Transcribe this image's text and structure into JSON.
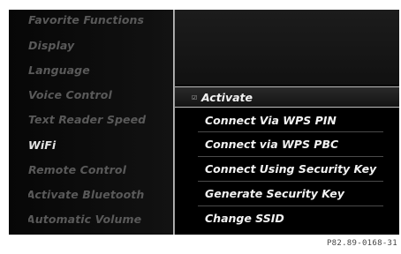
{
  "left_menu": {
    "items": [
      {
        "label": "Favorite Functions",
        "state": "normal"
      },
      {
        "label": "Display",
        "state": "normal"
      },
      {
        "label": "Language",
        "state": "normal"
      },
      {
        "label": "Voice Control",
        "state": "normal"
      },
      {
        "label": "Text Reader Speed",
        "state": "normal"
      },
      {
        "label": "WiFi",
        "state": "selected"
      },
      {
        "label": "Remote Control",
        "state": "normal"
      },
      {
        "label": "Activate Bluetooth",
        "state": "checked"
      },
      {
        "label": "Automatic Volume",
        "state": "option"
      }
    ],
    "check_glyph": "☑",
    "option_glyph": "□"
  },
  "wifi_submenu": {
    "items": [
      {
        "label": "Activate",
        "highlighted": true,
        "checked": true
      },
      {
        "label": "Connect Via WPS PIN",
        "highlighted": false,
        "checked": false
      },
      {
        "label": "Connect via WPS PBC",
        "highlighted": false,
        "checked": false
      },
      {
        "label": "Connect Using Security Key",
        "highlighted": false,
        "checked": false
      },
      {
        "label": "Generate Security Key",
        "highlighted": false,
        "checked": false
      },
      {
        "label": "Change SSID",
        "highlighted": false,
        "checked": false
      }
    ],
    "check_glyph": "☑"
  },
  "figure_code": "P82.89-0168-31",
  "colors": {
    "screen_background": "#0b0b0b",
    "menu_inactive": "#595959",
    "menu_selected": "#e4e4e4",
    "submenu_text": "#f2f2f2"
  }
}
